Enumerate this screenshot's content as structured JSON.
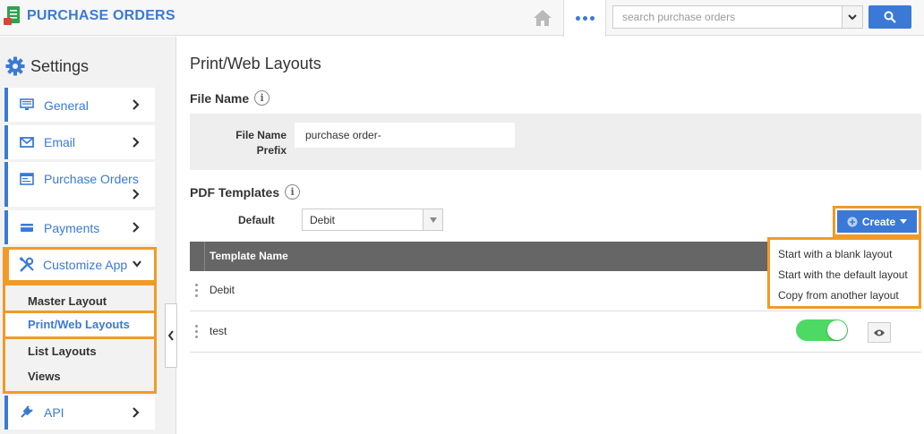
{
  "header": {
    "title": "PURCHASE ORDERS",
    "search_placeholder": "search purchase orders"
  },
  "sidebar": {
    "heading": "Settings",
    "items": [
      {
        "label": "General",
        "icon": "monitor-icon"
      },
      {
        "label": "Email",
        "icon": "envelope-icon"
      },
      {
        "label": "Purchase Orders",
        "icon": "window-icon"
      },
      {
        "label": "Payments",
        "icon": "credit-card-icon"
      },
      {
        "label": "Customize App",
        "icon": "wrench-screwdriver-icon"
      },
      {
        "label": "API",
        "icon": "plug-icon"
      }
    ],
    "sub_items": [
      "Master Layout",
      "Print/Web Layouts",
      "List Layouts",
      "Views"
    ],
    "active_sub_item": "Print/Web Layouts"
  },
  "main": {
    "title": "Print/Web Layouts",
    "file_name": {
      "section_title": "File Name",
      "prefix_label_line1": "File Name",
      "prefix_label_line2": "Prefix",
      "prefix_value": "purchase order-"
    },
    "pdf_templates": {
      "section_title": "PDF Templates",
      "default_label": "Default",
      "default_value": "Debit",
      "create_label": "Create",
      "create_menu": [
        "Start with a blank layout",
        "Start with the default layout",
        "Copy from another layout"
      ],
      "column_header": "Template Name",
      "rows": [
        {
          "name": "Debit"
        },
        {
          "name": "test",
          "enabled": true
        }
      ]
    }
  },
  "colors": {
    "accent": "#3a7ad6",
    "highlight": "#f39a26",
    "toggle_on": "#4cd964"
  }
}
